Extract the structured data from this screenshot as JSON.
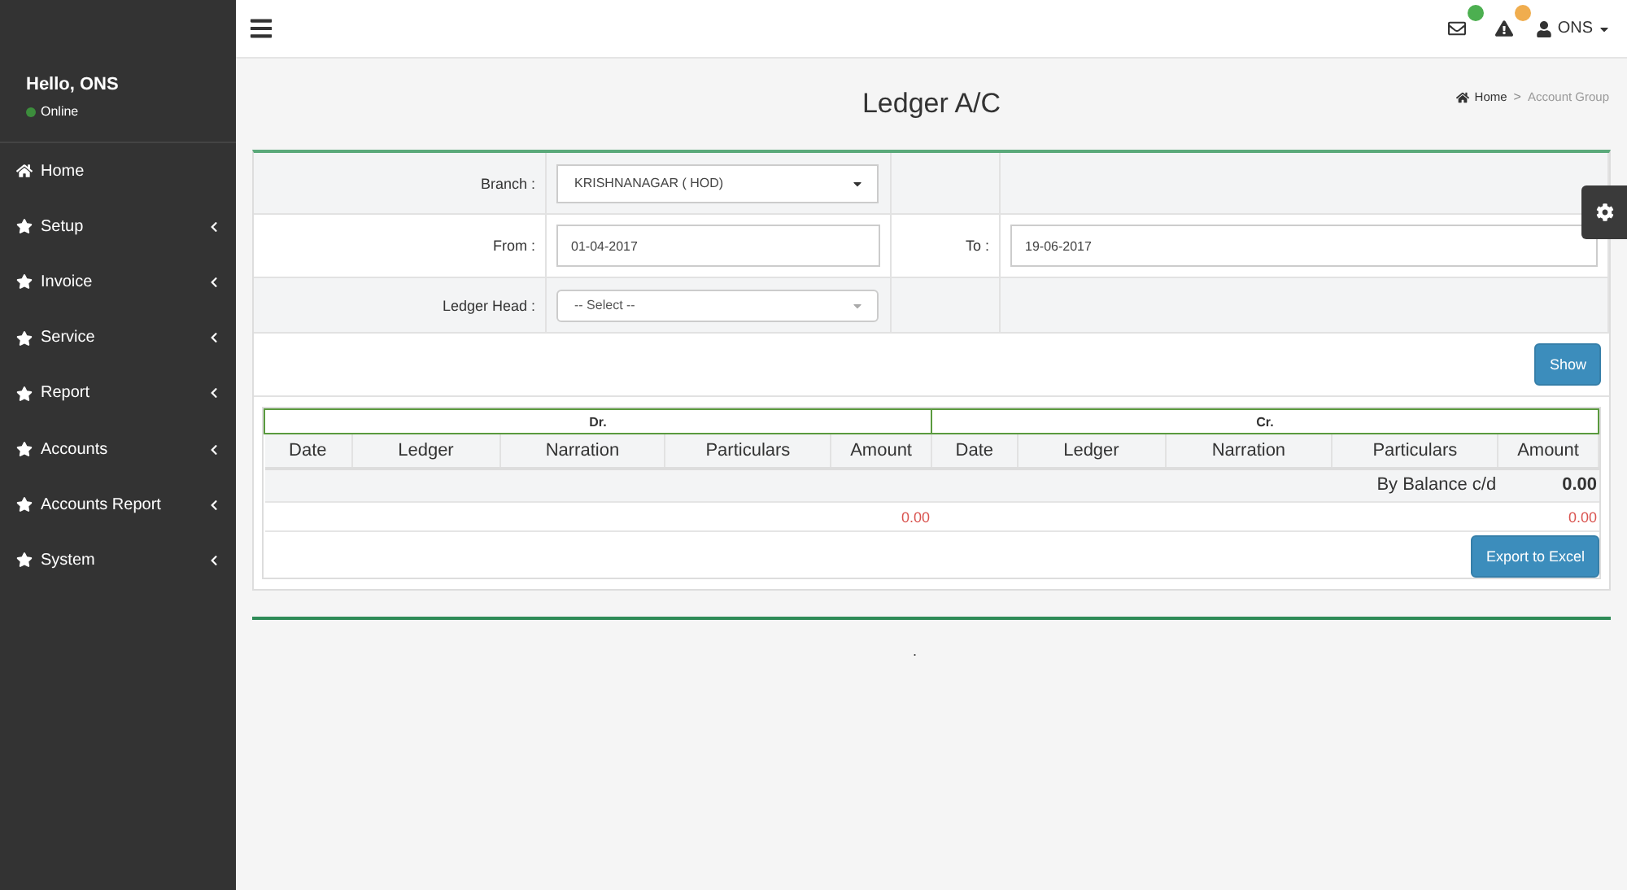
{
  "topbar": {
    "notifications": [
      {
        "kind": "mail",
        "color": "#4caf50"
      },
      {
        "kind": "alert",
        "color": "#f0ad4e"
      }
    ],
    "user": "ONS"
  },
  "sidebar": {
    "greeting": "Hello, ONS",
    "status": "Online",
    "items": [
      {
        "label": "Home",
        "kind": "home",
        "has_submenu": false
      },
      {
        "label": "Setup",
        "kind": "star",
        "has_submenu": true
      },
      {
        "label": "Invoice",
        "kind": "star",
        "has_submenu": true
      },
      {
        "label": "Service",
        "kind": "star",
        "has_submenu": true
      },
      {
        "label": "Report",
        "kind": "star",
        "has_submenu": true
      },
      {
        "label": "Accounts",
        "kind": "star",
        "has_submenu": true
      },
      {
        "label": "Accounts Report",
        "kind": "star",
        "has_submenu": true
      },
      {
        "label": "System",
        "kind": "star",
        "has_submenu": true
      }
    ]
  },
  "page_title": "Ledger A/C",
  "breadcrumb": [
    "Home",
    "Account Group"
  ],
  "breadcrumb_separator": ">",
  "form": {
    "branch": {
      "label": "Branch :",
      "value": "KRISHNANAGAR ( HOD)"
    },
    "from": {
      "label": "From :",
      "value": "01-04-2017"
    },
    "to": {
      "label": "To :",
      "value": "19-06-2017"
    },
    "ledger_head": {
      "label": "Ledger Head :",
      "placeholder": "-- Select --"
    },
    "show_button": "Show"
  },
  "table": {
    "dr_heading": "Dr.",
    "cr_heading": "Cr.",
    "columns": [
      "Date",
      "Ledger",
      "Narration",
      "Particulars",
      "Amount",
      "Date",
      "Ledger",
      "Narration",
      "Particulars",
      "Amount"
    ],
    "rows": [
      {
        "kind": "balance",
        "cells": {
          "cr_particulars": "By Balance c/d",
          "cr_amount": "0.00"
        }
      },
      {
        "kind": "total",
        "cells": {
          "dr_amount": "0.00",
          "cr_amount": "0.00"
        }
      }
    ]
  },
  "export_button": "Export to Excel",
  "footer_text": "."
}
